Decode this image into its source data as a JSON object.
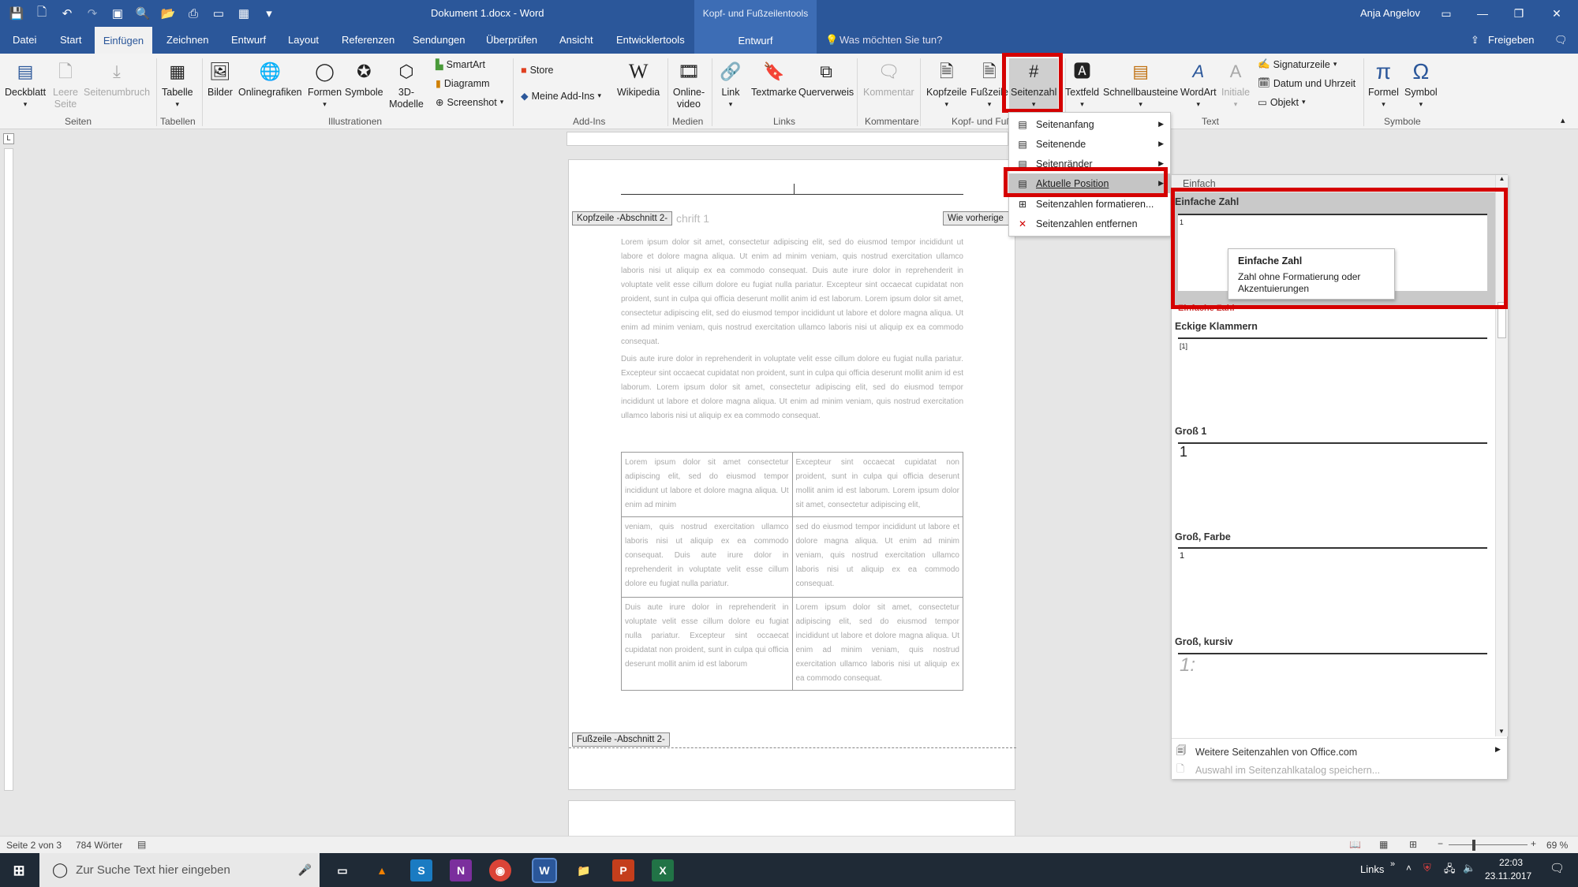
{
  "window": {
    "title": "Dokument 1.docx - Word",
    "context_tab_group": "Kopf- und Fußzeilentools",
    "user": "Anja Angelov"
  },
  "tabs": [
    "Datei",
    "Start",
    "Einfügen",
    "Zeichnen",
    "Entwurf",
    "Layout",
    "Referenzen",
    "Sendungen",
    "Überprüfen",
    "Ansicht",
    "Entwicklertools"
  ],
  "context_tab": "Entwurf",
  "tellme": "Was möchten Sie tun?",
  "share": "Freigeben",
  "ribbon": {
    "deckblatt": "Deckblatt",
    "leere_seite": "Leere Seite",
    "seitenumbruch": "Seitenumbruch",
    "tabelle": "Tabelle",
    "bilder": "Bilder",
    "onlinegrafiken": "Onlinegrafiken",
    "formen": "Formen",
    "symbole_btn": "Symbole",
    "modelle": "3D-Modelle",
    "smartart": "SmartArt",
    "diagramm": "Diagramm",
    "screenshot": "Screenshot",
    "store": "Store",
    "meine_addins": "Meine Add-Ins",
    "wikipedia": "Wikipedia",
    "onlinevideo": "Online-video",
    "link": "Link",
    "textmarke": "Textmarke",
    "querverweis": "Querverweis",
    "kommentar": "Kommentar",
    "kopfzeile": "Kopfzeile",
    "fusszeile": "Fußzeile",
    "seitenzahl": "Seitenzahl",
    "textfeld": "Textfeld",
    "schnellbausteine": "Schnellbausteine",
    "wordart": "WordArt",
    "initiale": "Initiale",
    "signaturzeile": "Signaturzeile",
    "datum": "Datum und Uhrzeit",
    "objekt": "Objekt",
    "formel": "Formel",
    "symbol": "Symbol",
    "groups": {
      "seiten": "Seiten",
      "tabellen": "Tabellen",
      "illustrationen": "Illustrationen",
      "addins": "Add-Ins",
      "medien": "Medien",
      "links": "Links",
      "kommentare": "Kommentare",
      "kopf_fuss": "Kopf- und Fuß",
      "text": "Text",
      "symbole": "Symbole"
    }
  },
  "document": {
    "header_tag": "Kopfzeile -Abschnitt 2-",
    "wie_vorherige": "Wie vorherige",
    "heading_fragment": "chrift 1",
    "para1": "Lorem ipsum dolor sit amet, consectetur adipiscing elit, sed do eiusmod tempor incididunt ut labore et dolore magna aliqua. Ut enim ad minim veniam, quis nostrud exercitation ullamco laboris nisi ut aliquip ex ea commodo consequat. Duis aute irure dolor in reprehenderit in voluptate velit esse cillum dolore eu fugiat nulla pariatur. Excepteur sint occaecat cupidatat non proident, sunt in culpa qui officia deserunt mollit anim id est laborum. Lorem ipsum dolor sit amet, consectetur adipiscing elit, sed do eiusmod tempor incididunt ut labore et dolore magna aliqua. Ut enim ad minim veniam, quis nostrud exercitation ullamco laboris nisi ut aliquip ex ea commodo consequat.",
    "para2": "Duis aute irure dolor in reprehenderit in voluptate velit esse cillum dolore eu fugiat nulla pariatur. Excepteur sint occaecat cupidatat non proident, sunt in culpa qui officia deserunt mollit anim id est laborum. Lorem ipsum dolor sit amet, consectetur adipiscing elit, sed do eiusmod tempor incididunt ut labore et dolore magna aliqua. Ut enim ad minim veniam, quis nostrud exercitation ullamco laboris nisi ut aliquip ex ea commodo consequat.",
    "table": [
      [
        "Lorem ipsum dolor sit amet consectetur adipiscing elit, sed do eiusmod tempor incididunt ut labore et dolore magna aliqua. Ut enim ad minim",
        "Excepteur sint occaecat cupidatat non proident, sunt in culpa qui officia deserunt mollit anim id est laborum. Lorem ipsum dolor sit amet, consectetur adipiscing elit,"
      ],
      [
        "veniam, quis nostrud exercitation ullamco laboris nisi ut aliquip ex ea commodo consequat. Duis aute irure dolor in reprehenderit in voluptate velit esse cillum dolore eu fugiat nulla pariatur.",
        "sed do eiusmod tempor incididunt ut labore et dolore magna aliqua. Ut enim ad minim veniam, quis nostrud exercitation ullamco laboris nisi ut aliquip ex ea commodo consequat."
      ],
      [
        "Duis aute irure dolor in reprehenderit in voluptate velit esse cillum dolore eu fugiat nulla pariatur. Excepteur sint occaecat cupidatat non proident, sunt in culpa qui officia deserunt mollit anim id est laborum",
        "Lorem ipsum dolor sit amet, consectetur adipiscing elit, sed do eiusmod tempor incididunt ut labore et dolore magna aliqua. Ut enim ad minim veniam, quis nostrud exercitation ullamco laboris nisi ut aliquip ex ea commodo consequat."
      ]
    ],
    "footer_tag": "Fußzeile -Abschnitt 2-"
  },
  "menu": {
    "items": [
      "Seitenanfang",
      "Seitenende",
      "Seitenränder",
      "Aktuelle Position",
      "Seitenzahlen formatieren...",
      "Seitenzahlen entfernen"
    ]
  },
  "gallery": {
    "section": "Einfach",
    "items": [
      {
        "label": "Einfache Zahl",
        "sample": "1"
      },
      {
        "label": "Eckige Klammern",
        "sample": "[1]"
      },
      {
        "label": "Groß 1",
        "sample": "1"
      },
      {
        "label": "Groß, Farbe",
        "sample": "1"
      },
      {
        "label": "Groß, kursiv",
        "sample": "1:"
      }
    ],
    "hidden_label": "Einfache Zahl",
    "more": "Weitere Seitenzahlen von Office.com",
    "save": "Auswahl im Seitenzahlkatalog speichern..."
  },
  "tooltip": {
    "title": "Einfache Zahl",
    "desc": "Zahl ohne Formatierung oder Akzentuierungen"
  },
  "status": {
    "page": "Seite 2 von 3",
    "words": "784 Wörter",
    "zoom": "69 %"
  },
  "taskbar": {
    "search": "Zur Suche Text hier eingeben",
    "links": "Links",
    "time": "22:03",
    "date": "23.11.2017"
  },
  "colors": {
    "word_blue": "#2b579a",
    "highlight": "#d50000"
  }
}
